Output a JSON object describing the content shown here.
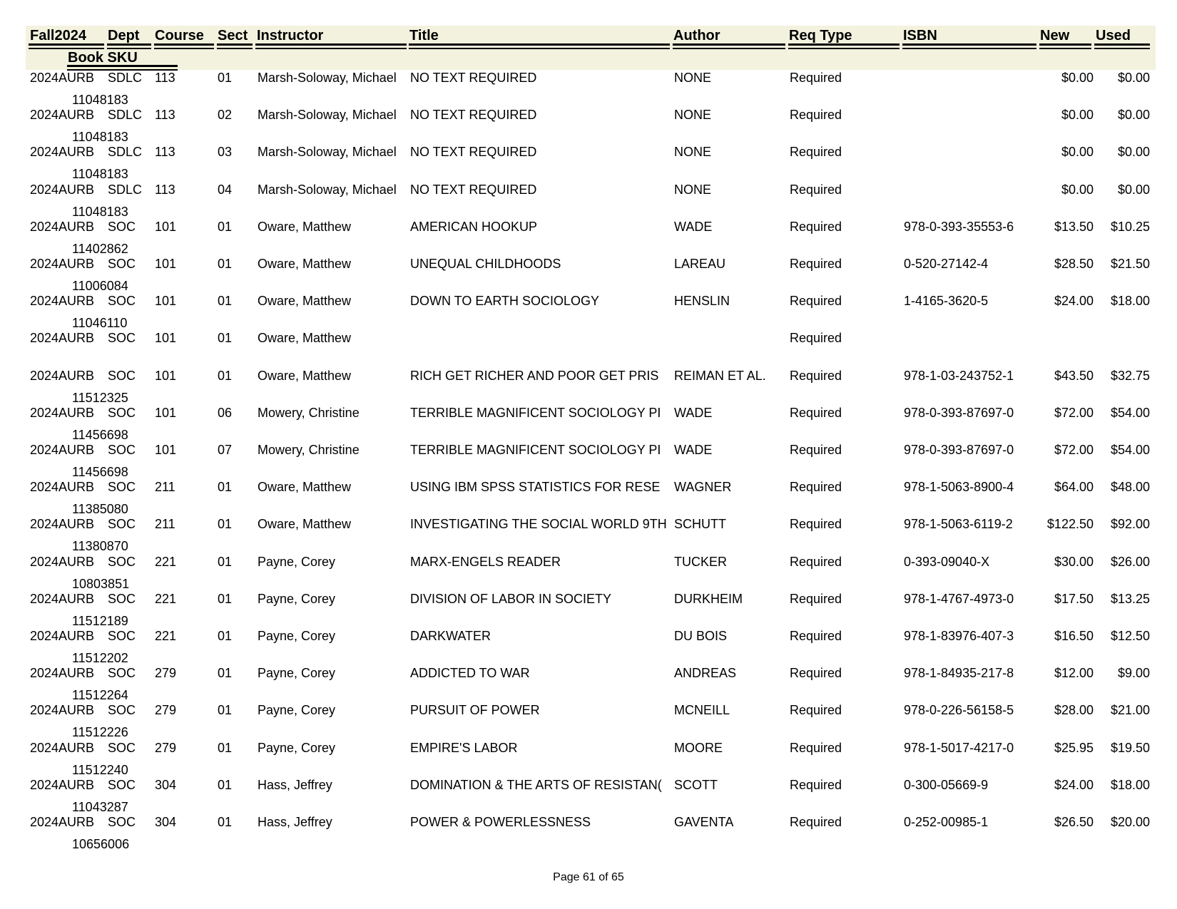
{
  "header": {
    "term": "Fall2024",
    "dept": "Dept",
    "course": "Course",
    "sect": "Sect",
    "instructor": "Instructor",
    "title": "Title",
    "author": "Author",
    "req_type": "Req Type",
    "isbn": "ISBN",
    "new": "New",
    "used": "Used",
    "book_sku": "Book SKU"
  },
  "rows": [
    {
      "term": "2024AURB",
      "dept": "SDLC",
      "course": "113",
      "sect": "01",
      "instructor": "Marsh-Soloway, Michael",
      "title": "NO TEXT REQUIRED",
      "author": "NONE",
      "req_type": "Required",
      "isbn": "",
      "new": "$0.00",
      "used": "$0.00",
      "sku": "11048183"
    },
    {
      "term": "2024AURB",
      "dept": "SDLC",
      "course": "113",
      "sect": "02",
      "instructor": "Marsh-Soloway, Michael",
      "title": "NO TEXT REQUIRED",
      "author": "NONE",
      "req_type": "Required",
      "isbn": "",
      "new": "$0.00",
      "used": "$0.00",
      "sku": "11048183"
    },
    {
      "term": "2024AURB",
      "dept": "SDLC",
      "course": "113",
      "sect": "03",
      "instructor": "Marsh-Soloway, Michael",
      "title": "NO TEXT REQUIRED",
      "author": "NONE",
      "req_type": "Required",
      "isbn": "",
      "new": "$0.00",
      "used": "$0.00",
      "sku": "11048183"
    },
    {
      "term": "2024AURB",
      "dept": "SDLC",
      "course": "113",
      "sect": "04",
      "instructor": "Marsh-Soloway, Michael",
      "title": "NO TEXT REQUIRED",
      "author": "NONE",
      "req_type": "Required",
      "isbn": "",
      "new": "$0.00",
      "used": "$0.00",
      "sku": "11048183"
    },
    {
      "term": "2024AURB",
      "dept": "SOC",
      "course": "101",
      "sect": "01",
      "instructor": "Oware, Matthew",
      "title": "AMERICAN HOOKUP",
      "author": "WADE",
      "req_type": "Required",
      "isbn": "978-0-393-35553-6",
      "new": "$13.50",
      "used": "$10.25",
      "sku": "11402862"
    },
    {
      "term": "2024AURB",
      "dept": "SOC",
      "course": "101",
      "sect": "01",
      "instructor": "Oware, Matthew",
      "title": "UNEQUAL CHILDHOODS",
      "author": "LAREAU",
      "req_type": "Required",
      "isbn": "0-520-27142-4",
      "new": "$28.50",
      "used": "$21.50",
      "sku": "11006084"
    },
    {
      "term": "2024AURB",
      "dept": "SOC",
      "course": "101",
      "sect": "01",
      "instructor": "Oware, Matthew",
      "title": "DOWN TO EARTH SOCIOLOGY",
      "author": "HENSLIN",
      "req_type": "Required",
      "isbn": "1-4165-3620-5",
      "new": "$24.00",
      "used": "$18.00",
      "sku": "11046110"
    },
    {
      "term": "2024AURB",
      "dept": "SOC",
      "course": "101",
      "sect": "01",
      "instructor": "Oware, Matthew",
      "title": "",
      "author": "",
      "req_type": "Required",
      "isbn": "",
      "new": "",
      "used": "",
      "sku": ""
    },
    {
      "term": "2024AURB",
      "dept": "SOC",
      "course": "101",
      "sect": "01",
      "instructor": "Oware, Matthew",
      "title": "RICH GET RICHER AND POOR GET PRIS",
      "author": "REIMAN ET AL.",
      "req_type": "Required",
      "isbn": "978-1-03-243752-1",
      "new": "$43.50",
      "used": "$32.75",
      "sku": "11512325"
    },
    {
      "term": "2024AURB",
      "dept": "SOC",
      "course": "101",
      "sect": "06",
      "instructor": "Mowery, Christine",
      "title": "TERRIBLE MAGNIFICENT SOCIOLOGY PI",
      "author": "WADE",
      "req_type": "Required",
      "isbn": "978-0-393-87697-0",
      "new": "$72.00",
      "used": "$54.00",
      "sku": "11456698"
    },
    {
      "term": "2024AURB",
      "dept": "SOC",
      "course": "101",
      "sect": "07",
      "instructor": "Mowery, Christine",
      "title": "TERRIBLE MAGNIFICENT SOCIOLOGY PI",
      "author": "WADE",
      "req_type": "Required",
      "isbn": "978-0-393-87697-0",
      "new": "$72.00",
      "used": "$54.00",
      "sku": "11456698"
    },
    {
      "term": "2024AURB",
      "dept": "SOC",
      "course": "211",
      "sect": "01",
      "instructor": "Oware, Matthew",
      "title": "USING IBM SPSS STATISTICS FOR RESE",
      "author": "WAGNER",
      "req_type": "Required",
      "isbn": "978-1-5063-8900-4",
      "new": "$64.00",
      "used": "$48.00",
      "sku": "11385080"
    },
    {
      "term": "2024AURB",
      "dept": "SOC",
      "course": "211",
      "sect": "01",
      "instructor": "Oware, Matthew",
      "title": "INVESTIGATING THE SOCIAL WORLD 9TH",
      "author": "SCHUTT",
      "req_type": "Required",
      "isbn": "978-1-5063-6119-2",
      "new": "$122.50",
      "used": "$92.00",
      "sku": "11380870"
    },
    {
      "term": "2024AURB",
      "dept": "SOC",
      "course": "221",
      "sect": "01",
      "instructor": "Payne, Corey",
      "title": "MARX-ENGELS READER",
      "author": "TUCKER",
      "req_type": "Required",
      "isbn": "0-393-09040-X",
      "new": "$30.00",
      "used": "$26.00",
      "sku": "10803851"
    },
    {
      "term": "2024AURB",
      "dept": "SOC",
      "course": "221",
      "sect": "01",
      "instructor": "Payne, Corey",
      "title": "DIVISION OF LABOR IN SOCIETY",
      "author": "DURKHEIM",
      "req_type": "Required",
      "isbn": "978-1-4767-4973-0",
      "new": "$17.50",
      "used": "$13.25",
      "sku": "11512189"
    },
    {
      "term": "2024AURB",
      "dept": "SOC",
      "course": "221",
      "sect": "01",
      "instructor": "Payne, Corey",
      "title": "DARKWATER",
      "author": "DU BOIS",
      "req_type": "Required",
      "isbn": "978-1-83976-407-3",
      "new": "$16.50",
      "used": "$12.50",
      "sku": "11512202"
    },
    {
      "term": "2024AURB",
      "dept": "SOC",
      "course": "279",
      "sect": "01",
      "instructor": "Payne, Corey",
      "title": "ADDICTED TO WAR",
      "author": "ANDREAS",
      "req_type": "Required",
      "isbn": "978-1-84935-217-8",
      "new": "$12.00",
      "used": "$9.00",
      "sku": "11512264"
    },
    {
      "term": "2024AURB",
      "dept": "SOC",
      "course": "279",
      "sect": "01",
      "instructor": "Payne, Corey",
      "title": "PURSUIT OF POWER",
      "author": "MCNEILL",
      "req_type": "Required",
      "isbn": "978-0-226-56158-5",
      "new": "$28.00",
      "used": "$21.00",
      "sku": "11512226"
    },
    {
      "term": "2024AURB",
      "dept": "SOC",
      "course": "279",
      "sect": "01",
      "instructor": "Payne, Corey",
      "title": "EMPIRE'S LABOR",
      "author": "MOORE",
      "req_type": "Required",
      "isbn": "978-1-5017-4217-0",
      "new": "$25.95",
      "used": "$19.50",
      "sku": "11512240"
    },
    {
      "term": "2024AURB",
      "dept": "SOC",
      "course": "304",
      "sect": "01",
      "instructor": "Hass, Jeffrey",
      "title": "DOMINATION & THE ARTS OF RESISTAN(",
      "author": "SCOTT",
      "req_type": "Required",
      "isbn": "0-300-05669-9",
      "new": "$24.00",
      "used": "$18.00",
      "sku": "11043287"
    },
    {
      "term": "2024AURB",
      "dept": "SOC",
      "course": "304",
      "sect": "01",
      "instructor": "Hass, Jeffrey",
      "title": "POWER & POWERLESSNESS",
      "author": "GAVENTA",
      "req_type": "Required",
      "isbn": "0-252-00985-1",
      "new": "$26.50",
      "used": "$20.00",
      "sku": "10656006"
    }
  ],
  "footer": {
    "page_label": "Page 61 of 65"
  },
  "colors": {
    "header_band": "#f2f2de"
  }
}
